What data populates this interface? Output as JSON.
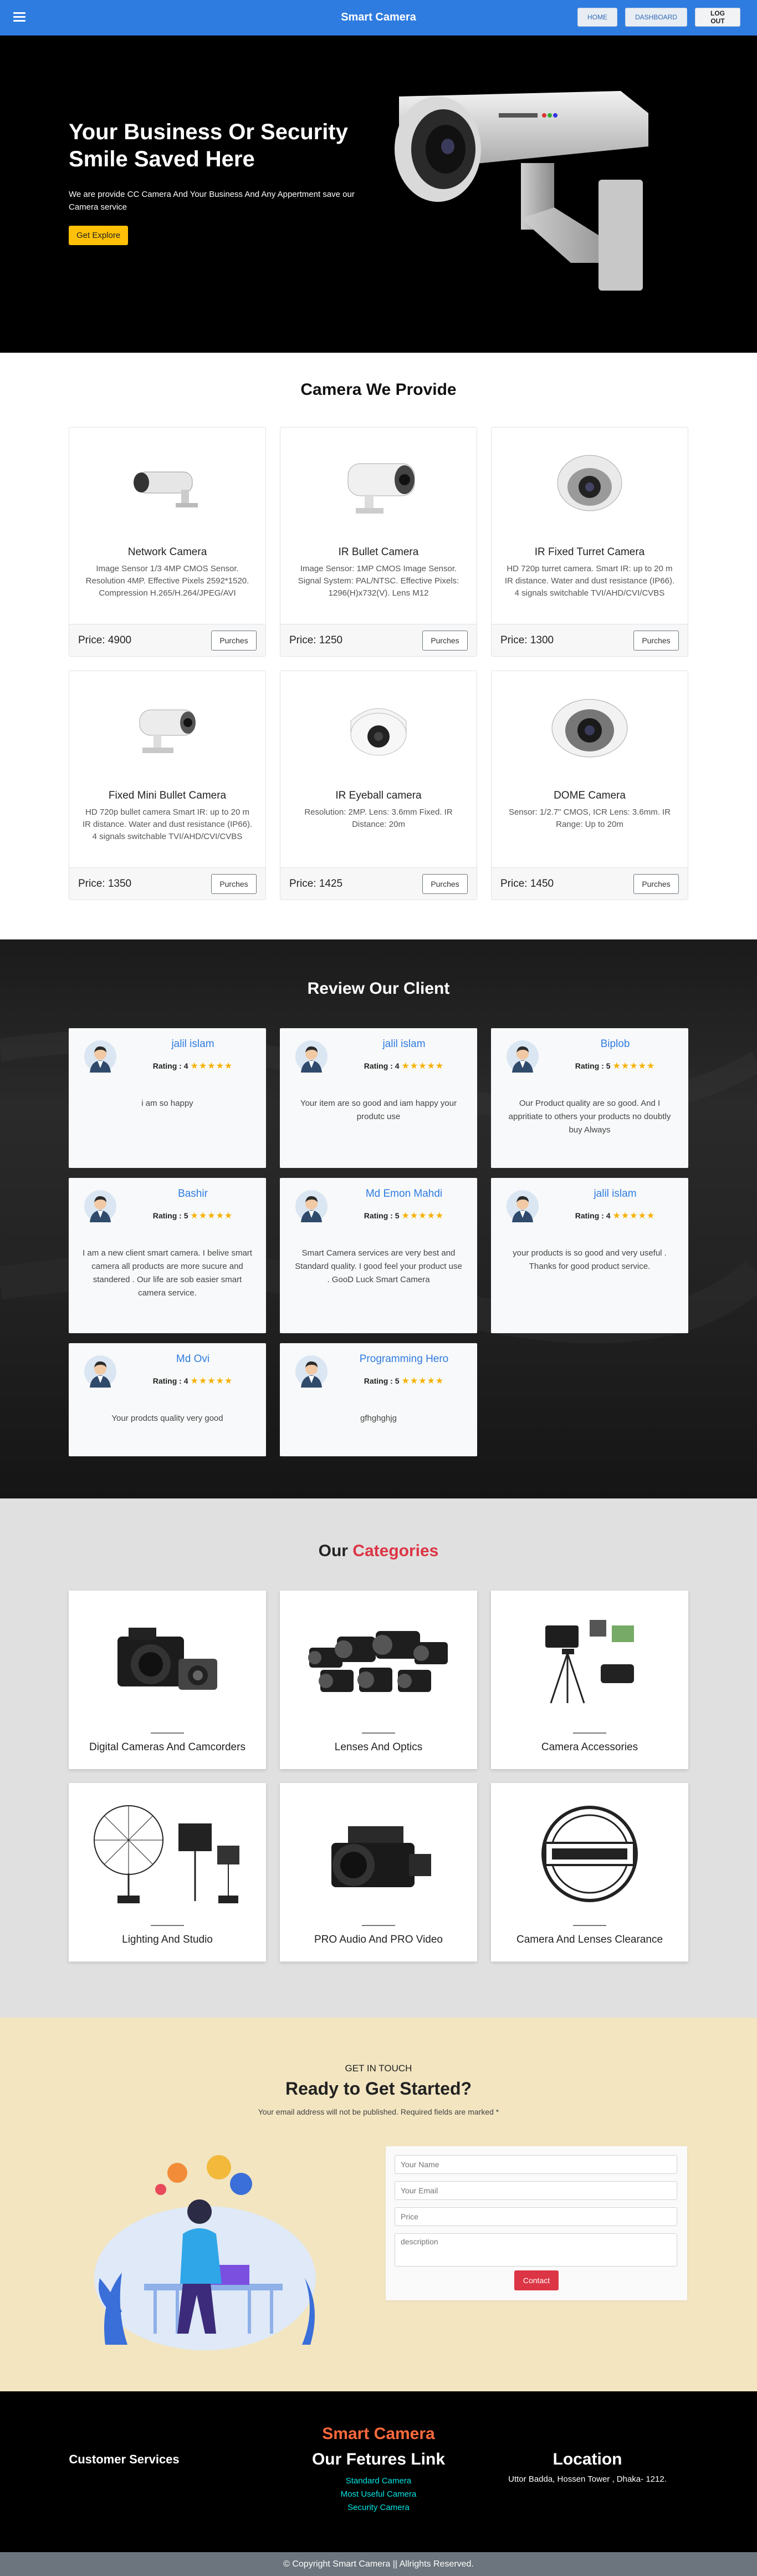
{
  "navbar": {
    "brand": "Smart Camera",
    "home": "HOME",
    "dashboard": "DASHBOARD",
    "logout": "LOG OUT",
    "bg_color": "#2f7ce0"
  },
  "hero": {
    "title": "Your Business Or Security Smile Saved Here",
    "subtitle": "We are provide CC Camera And Your Business And Any Appertment save our Camera service",
    "button": "Get Explore"
  },
  "cameras": {
    "title": "Camera We Provide",
    "purchase_label": "Purches",
    "items": [
      {
        "name": "Network Camera",
        "desc": "Image Sensor 1/3 4MP CMOS Sensor. Resolution 4MP. Effective Pixels 2592*1520. Compression H.265/H.264/JPEG/AVI",
        "price": "Price: 4900"
      },
      {
        "name": "IR Bullet Camera",
        "desc": "Image Sensor: 1MP CMOS Image Sensor. Signal System: PAL/NTSC. Effective Pixels: 1296(H)x732(V). Lens M12",
        "price": "Price: 1250"
      },
      {
        "name": "IR Fixed Turret Camera",
        "desc": "HD 720p turret camera. Smart IR: up to 20 m IR distance. Water and dust resistance (IP66). 4 signals switchable TVI/AHD/CVI/CVBS",
        "price": "Price: 1300"
      },
      {
        "name": "Fixed Mini Bullet Camera",
        "desc": "HD 720p bullet camera Smart IR: up to 20 m IR distance. Water and dust resistance (IP66). 4 signals switchable TVI/AHD/CVI/CVBS",
        "price": "Price: 1350"
      },
      {
        "name": "IR Eyeball camera",
        "desc": "Resolution: 2MP. Lens: 3.6mm Fixed. IR Distance: 20m",
        "price": "Price: 1425"
      },
      {
        "name": "DOME Camera",
        "desc": "Sensor: 1/2.7\" CMOS, ICR Lens: 3.6mm. IR Range: Up to 20m",
        "price": "Price: 1450"
      }
    ]
  },
  "reviews": {
    "title": "Review Our Client",
    "rating_label": "Rating :",
    "items": [
      {
        "name": "jalil islam",
        "rating": "4",
        "stars": "★★★★★",
        "text": "i am so happy"
      },
      {
        "name": "jalil islam",
        "rating": "4",
        "stars": "★★★★★",
        "text": "Your item are so good and iam happy your produtc use"
      },
      {
        "name": "Biplob",
        "rating": "5",
        "stars": "★★★★★",
        "text": "Our Product quality are so good. And I appritiate to others your products no doubtly buy Always"
      },
      {
        "name": "Bashir",
        "rating": "5",
        "stars": "★★★★★",
        "text": "I am a new client smart camera. I belive smart camera all products are more sucure and standered . Our life are sob easier smart camera service."
      },
      {
        "name": "Md Emon Mahdi",
        "rating": "5",
        "stars": "★★★★★",
        "text": "Smart Camera services are very best and Standard quality. I good feel your product use . GooD Luck Smart Camera"
      },
      {
        "name": "jalil islam",
        "rating": "4",
        "stars": "★★★★★",
        "text": "your products is so good and very useful . Thanks for good product service."
      },
      {
        "name": "Md Ovi",
        "rating": "4",
        "stars": "★★★★★",
        "text": "Your prodcts quality very good"
      },
      {
        "name": "Programming Hero",
        "rating": "5",
        "stars": "★★★★★",
        "text": "gfhghghjg"
      }
    ]
  },
  "categories": {
    "title_prefix": "Our",
    "title_accent": "Categories",
    "accent_color": "#dc3545",
    "items": [
      {
        "name": "Digital Cameras And Camcorders"
      },
      {
        "name": "Lenses And Optics"
      },
      {
        "name": "Camera Accessories"
      },
      {
        "name": "Lighting And Studio"
      },
      {
        "name": "PRO Audio And PRO Video"
      },
      {
        "name": "Camera And Lenses Clearance"
      }
    ]
  },
  "contact": {
    "kicker": "GET IN TOUCH",
    "title": "Ready to Get Started?",
    "note": "Your email address will not be published. Required fields are marked *",
    "name_placeholder": "Your Name",
    "email_placeholder": "Your Email",
    "price_placeholder": "Price",
    "desc_placeholder": "description",
    "button": "Contact"
  },
  "footer": {
    "brand": "Smart Camera",
    "customer_services": "Customer Services",
    "links_title": "Our Fetures Link",
    "links": [
      "Standard Camera",
      "Most Useful Camera",
      "Security Camera"
    ],
    "location_title": "Location",
    "address": "Uttor Badda, Hossen Tower , Dhaka- 1212.",
    "copyright": "© Copyright Smart Camera || Allrights Reserved."
  }
}
